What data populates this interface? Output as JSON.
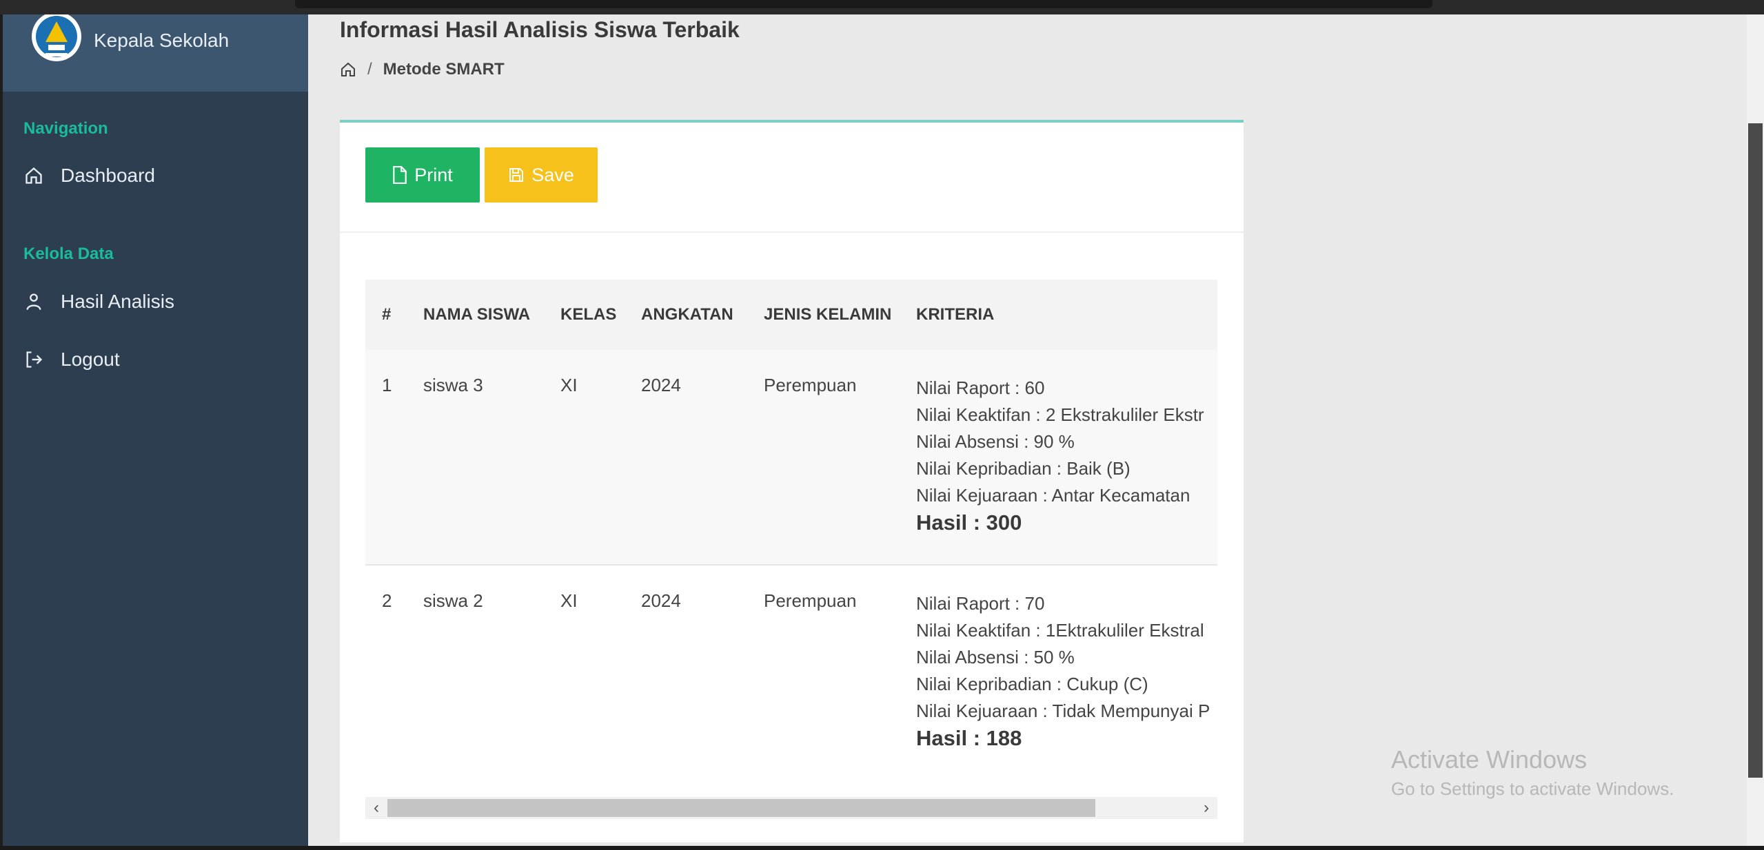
{
  "sidebar": {
    "brand": "Kepala Sekolah",
    "sections": [
      {
        "title": "Navigation",
        "items": [
          {
            "label": "Dashboard",
            "icon": "home-icon"
          }
        ]
      },
      {
        "title": "Kelola Data",
        "items": [
          {
            "label": "Hasil Analisis",
            "icon": "user-icon"
          },
          {
            "label": "Logout",
            "icon": "logout-icon"
          }
        ]
      }
    ]
  },
  "header": {
    "title": "Informasi Hasil Analisis Siswa Terbaik",
    "breadcrumb": {
      "separator": "/",
      "current": "Metode SMART"
    }
  },
  "toolbar": {
    "print_label": "Print",
    "save_label": "Save"
  },
  "colors": {
    "sidebar_bg": "#2c3e50",
    "accent": "#1abc9c",
    "print_button": "#1fb463",
    "save_button": "#f5c11a"
  },
  "table": {
    "columns": [
      "#",
      "NAMA SISWA",
      "KELAS",
      "ANGKATAN",
      "JENIS KELAMIN",
      "KRITERIA"
    ],
    "rows": [
      {
        "no": "1",
        "nama": "siswa 3",
        "kelas": "XI",
        "angkatan": "2024",
        "jenis_kelamin": "Perempuan",
        "kriteria": [
          "Nilai Raport : 60",
          "Nilai Keaktifan : 2 Ekstrakuliler Ekstr",
          "Nilai Absensi : 90 %",
          "Nilai Kepribadian : Baik (B)",
          "Nilai Kejuaraan : Antar Kecamatan"
        ],
        "hasil": "Hasil : 300"
      },
      {
        "no": "2",
        "nama": "siswa 2",
        "kelas": "XI",
        "angkatan": "2024",
        "jenis_kelamin": "Perempuan",
        "kriteria": [
          "Nilai Raport : 70",
          "Nilai Keaktifan : 1Ektrakuliler Ekstral",
          "Nilai Absensi : 50 %",
          "Nilai Kepribadian : Cukup (C)",
          "Nilai Kejuaraan : Tidak Mempunyai P"
        ],
        "hasil": "Hasil : 188"
      }
    ]
  },
  "watermark": {
    "line1": "Activate Windows",
    "line2": "Go to Settings to activate Windows."
  }
}
